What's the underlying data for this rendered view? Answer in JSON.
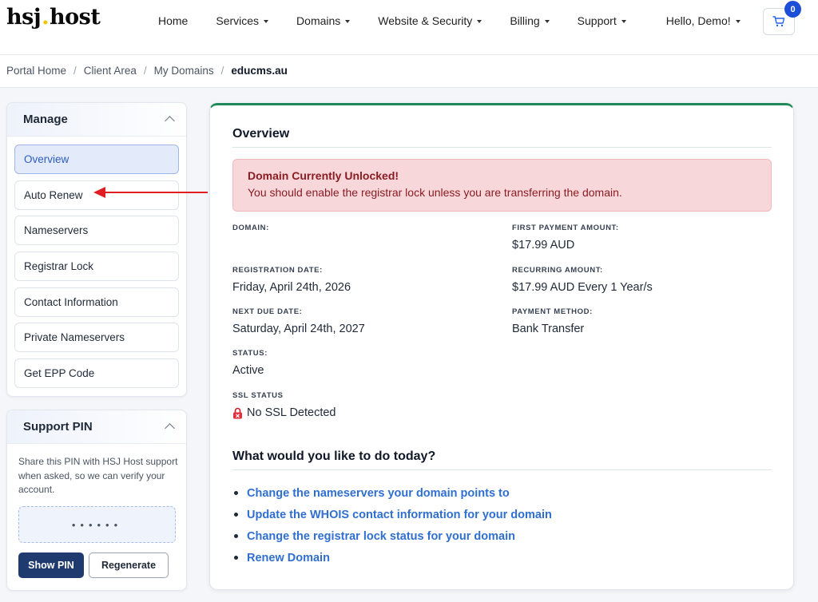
{
  "header": {
    "logo": {
      "left": "hsj",
      "dot": ".",
      "right": "host"
    },
    "nav": [
      {
        "label": "Home",
        "caret": false
      },
      {
        "label": "Services",
        "caret": true
      },
      {
        "label": "Domains",
        "caret": true
      },
      {
        "label": "Website & Security",
        "caret": true
      },
      {
        "label": "Billing",
        "caret": true
      },
      {
        "label": "Support",
        "caret": true
      },
      {
        "label": "Hello, Demo!",
        "caret": true
      }
    ],
    "cart_count": "0",
    "cart_icon": "shopping-cart-icon"
  },
  "breadcrumb": [
    "Portal Home",
    "Client Area",
    "My Domains",
    "educms.au"
  ],
  "sidebar": {
    "manage": {
      "title": "Manage",
      "items": [
        "Overview",
        "Auto Renew",
        "Nameservers",
        "Registrar Lock",
        "Contact Information",
        "Private Nameservers",
        "Get EPP Code"
      ],
      "active_index": 0
    },
    "support_pin": {
      "title": "Support PIN",
      "text": "Share this PIN with HSJ Host support when asked, so we can verify your account.",
      "masked_pin": "••••••",
      "show_label": "Show PIN",
      "regenerate_label": "Regenerate"
    }
  },
  "overview": {
    "title": "Overview",
    "alert": {
      "title": "Domain Currently Unlocked!",
      "text": "You should enable the registrar lock unless you are transferring the domain."
    },
    "fields": {
      "domain": {
        "label": "DOMAIN:",
        "value": ""
      },
      "registration_date": {
        "label": "REGISTRATION DATE:",
        "value": "Friday, April 24th, 2026"
      },
      "next_due_date": {
        "label": "NEXT DUE DATE:",
        "value": "Saturday, April 24th, 2027"
      },
      "status": {
        "label": "STATUS:",
        "value": "Active"
      },
      "ssl_status": {
        "label": "SSL STATUS",
        "value": "No SSL Detected"
      },
      "first_payment": {
        "label": "FIRST PAYMENT AMOUNT:",
        "value": "$17.99 AUD"
      },
      "recurring": {
        "label": "RECURRING AMOUNT:",
        "value": "$17.99 AUD Every 1 Year/s"
      },
      "payment_method": {
        "label": "PAYMENT METHOD:",
        "value": "Bank Transfer"
      }
    },
    "actions_title": "What would you like to do today?",
    "actions": [
      "Change the nameservers your domain points to",
      "Update the WHOIS contact information for your domain",
      "Change the registrar lock status for your domain",
      "Renew Domain"
    ]
  },
  "colors": {
    "accent": "#2f6fd1",
    "alert_bg": "#f8d7da",
    "alert_text": "#8a1c24",
    "annotation_arrow": "#e11d24",
    "card_top_border": "#1e8a57",
    "primary_button": "#1e3a6e"
  }
}
